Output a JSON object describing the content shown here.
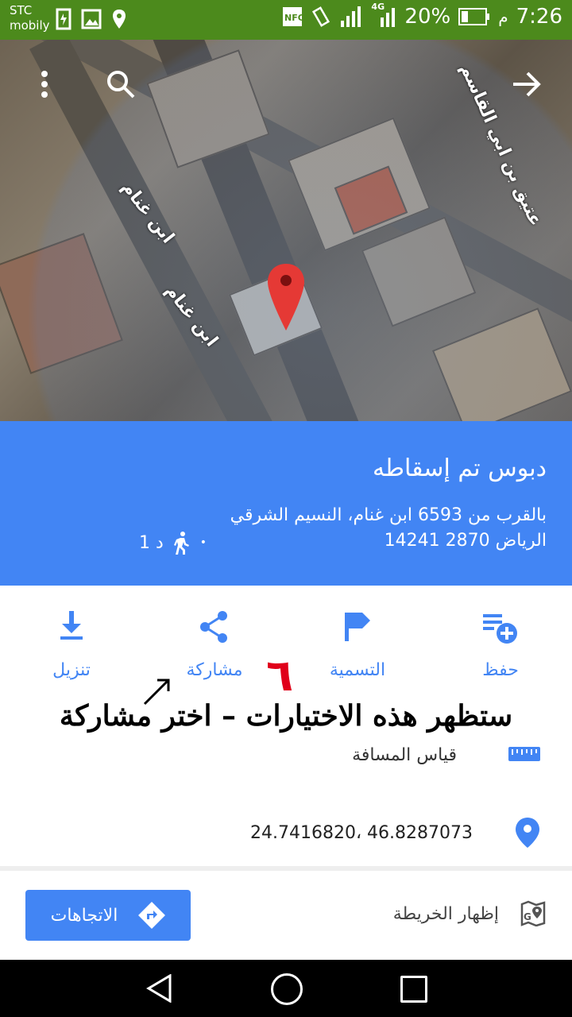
{
  "status_bar": {
    "carrier_line1": "STC",
    "carrier_line2": "mobily",
    "battery": "20%",
    "time": "7:26",
    "am_pm": "م",
    "network": "4G"
  },
  "map": {
    "street_labels": [
      "ابن غنام",
      "ابن غنام",
      "عتيق بن ابي القاسم"
    ],
    "icons": [
      "overflow-menu-icon",
      "search-icon",
      "forward-arrow-icon",
      "map-pin-icon"
    ]
  },
  "place_panel": {
    "title": "دبوس تم إسقاطه",
    "address_line1": "بالقرب من 6593 ابن غنام، النسيم الشرقي",
    "address_line2": "الرياض 2870 14241",
    "walk_time": "1 د",
    "color": "#4285f4"
  },
  "actions": [
    {
      "label": "حفظ",
      "icon": "save-list-icon"
    },
    {
      "label": "التسمية",
      "icon": "flag-icon"
    },
    {
      "label": "مشاركة",
      "icon": "share-icon"
    },
    {
      "label": "تنزيل",
      "icon": "download-icon"
    }
  ],
  "annotation": {
    "number": "٦",
    "text": "ستظهر هذه الاختيارات – اختر مشاركة"
  },
  "measure": {
    "label": "قياس المسافة",
    "icon": "ruler-icon"
  },
  "coordinates": {
    "value": "24.7416820، 46.8287073",
    "icon": "location-pin-icon"
  },
  "bottom_bar": {
    "directions_label": "الاتجاهات",
    "show_map_label": "إظهار الخريطة"
  }
}
